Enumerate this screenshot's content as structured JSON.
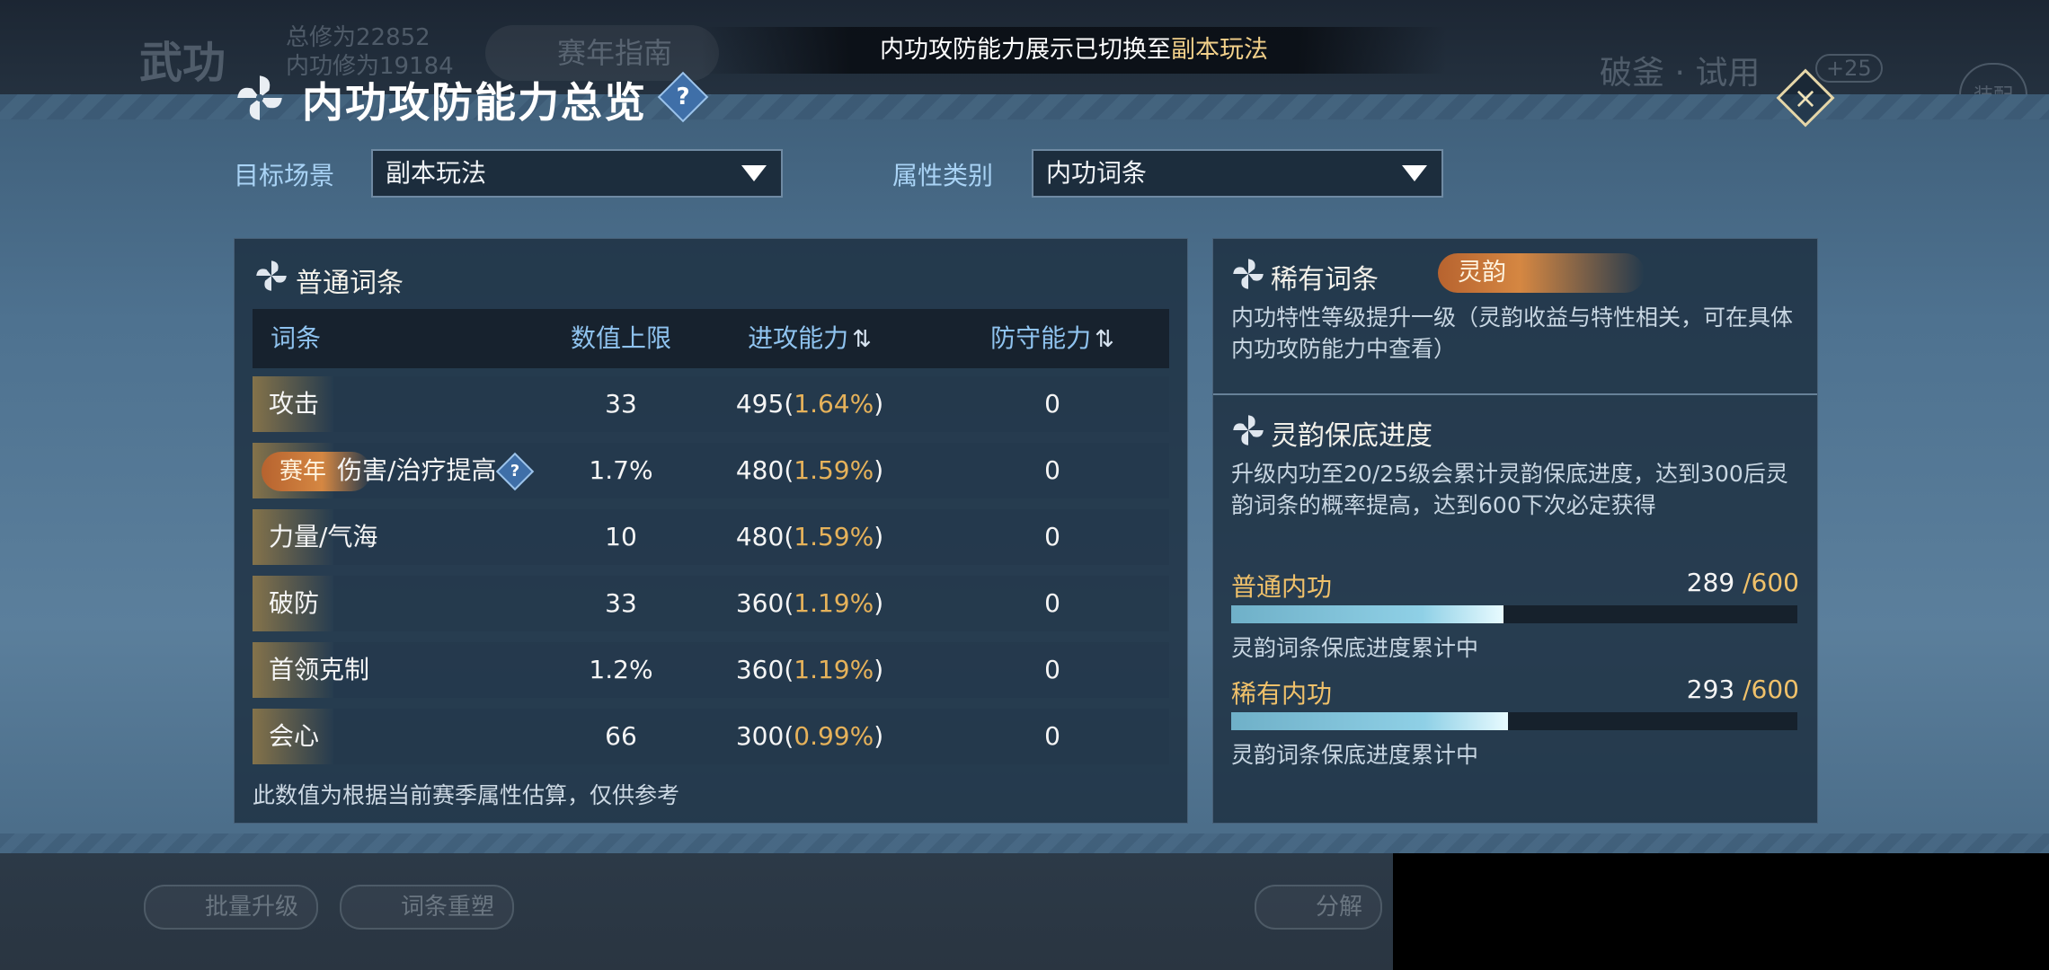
{
  "toast": {
    "prefix": "内功攻防能力展示已切换至",
    "highlight": "副本玩法"
  },
  "background": {
    "title": "武功",
    "stat_total": "总修为22852",
    "stat_inner": "内功修为19184",
    "guide": "赛年指南",
    "skill": "破釜 · 试用",
    "plus": "+25",
    "equip": "装配",
    "btn_batch": "批量升级",
    "btn_reshape": "词条重塑",
    "btn_decompose": "分解"
  },
  "header": {
    "title": "内功攻防能力总览",
    "help": "?",
    "close": "×"
  },
  "filters": {
    "scene_label": "目标场景",
    "scene_value": "副本玩法",
    "attr_label": "属性类别",
    "attr_value": "内功词条"
  },
  "common": {
    "title": "普通词条",
    "columns": {
      "name": "词条",
      "limit": "数值上限",
      "attack": "进攻能力",
      "defense": "防守能力"
    },
    "rows": [
      {
        "name": "攻击",
        "limit": "33",
        "atk": "495",
        "atk_pct": "1.64%",
        "def": "0"
      },
      {
        "tag": "赛年",
        "name": "伤害/治疗提高",
        "help": "?",
        "limit": "1.7%",
        "atk": "480",
        "atk_pct": "1.59%",
        "def": "0"
      },
      {
        "name": "力量/气海",
        "limit": "10",
        "atk": "480",
        "atk_pct": "1.59%",
        "def": "0"
      },
      {
        "name": "破防",
        "limit": "33",
        "atk": "360",
        "atk_pct": "1.19%",
        "def": "0"
      },
      {
        "name": "首领克制",
        "limit": "1.2%",
        "atk": "360",
        "atk_pct": "1.19%",
        "def": "0"
      },
      {
        "name": "会心",
        "limit": "66",
        "atk": "300",
        "atk_pct": "0.99%",
        "def": "0"
      }
    ],
    "footnote": "此数值为根据当前赛季属性估算，仅供参考"
  },
  "rare": {
    "title": "稀有词条",
    "badge": "灵韵",
    "desc": "内功特性等级提升一级（灵韵收益与特性相关，可在具体内功攻防能力中查看）"
  },
  "pity": {
    "title": "灵韵保底进度",
    "desc": "升级内功至20/25级会累计灵韵保底进度，达到300后灵韵词条的概率提高，达到600下次必定获得",
    "bars": [
      {
        "label": "普通内功",
        "value": "289",
        "total": "/600",
        "fraction": 0.4817,
        "note": "灵韵词条保底进度累计中"
      },
      {
        "label": "稀有内功",
        "value": "293",
        "total": "/600",
        "fraction": 0.4883,
        "note": "灵韵词条保底进度累计中"
      }
    ]
  }
}
